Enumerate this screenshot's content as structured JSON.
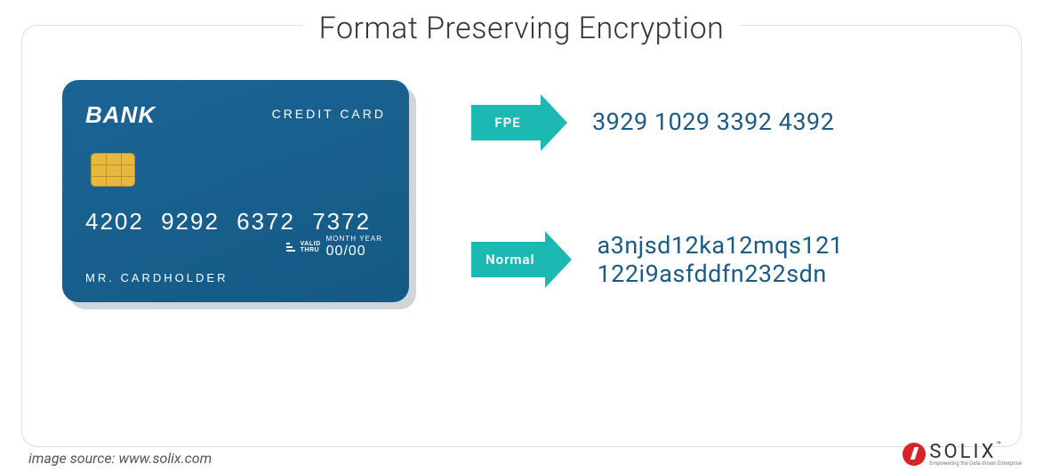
{
  "title": "Format Preserving Encryption",
  "card": {
    "bank": "BANK",
    "type": "CREDIT CARD",
    "number": "4202 9292 6372 7372",
    "valid_label_top": "VALID",
    "valid_label_bot": "THRU",
    "valid_my_top": "MONTH",
    "valid_my_bot": "YEAR",
    "valid_date": "00/00",
    "holder": "MR. CARDHOLDER"
  },
  "rows": {
    "fpe": {
      "label": "FPE",
      "output": "3929 1029 3392 4392"
    },
    "normal": {
      "label": "Normal",
      "output_l1": "a3njsd12ka12mqs121",
      "output_l2": "122i9asfddfn232sdn"
    }
  },
  "footer": {
    "source": "image source: www.solix.com",
    "logo_text": "SOLIX",
    "logo_tm": "™",
    "logo_sub": "Empowering the Data-driven Enterprise"
  }
}
